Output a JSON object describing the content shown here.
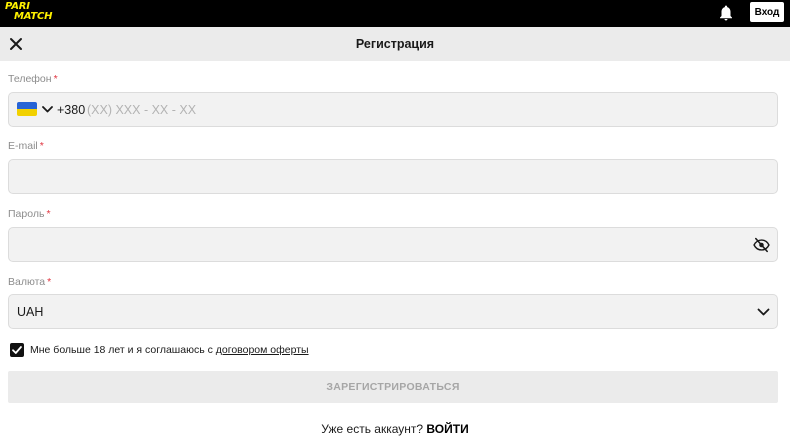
{
  "brand": {
    "logo_line1": "PARI",
    "logo_line2": "MATCH",
    "accent": "#fff200"
  },
  "topbar": {
    "bell_icon": "bell-icon",
    "login_label": "Вход"
  },
  "header": {
    "title": "Регистрация",
    "close_icon": "close-icon"
  },
  "form": {
    "phone": {
      "label": "Телефон",
      "required_mark": "*",
      "country_flag": "ukraine-flag",
      "prefix": "+380",
      "placeholder": "(XX) XXX - XX - XX",
      "value": ""
    },
    "email": {
      "label": "E-mail",
      "required_mark": "*",
      "value": ""
    },
    "password": {
      "label": "Пароль",
      "required_mark": "*",
      "value": "",
      "toggle_icon": "eye-slash-icon"
    },
    "currency": {
      "label": "Валюта",
      "required_mark": "*",
      "selected": "UAH"
    },
    "agreement": {
      "checked": true,
      "text": "Мне больше 18 лет и я соглашаюсь с ",
      "link_text": "договором оферты"
    },
    "submit_label": "ЗАРЕГИСТРИРОВАТЬСЯ"
  },
  "footer": {
    "question": "Уже есть аккаунт?",
    "login_link": "ВОЙТИ"
  },
  "colors": {
    "required": "#e0343f",
    "field_bg": "#f2f2f2",
    "header_bg": "#ebebeb",
    "flag_blue": "#2764d6",
    "flag_yellow": "#f2d100"
  }
}
